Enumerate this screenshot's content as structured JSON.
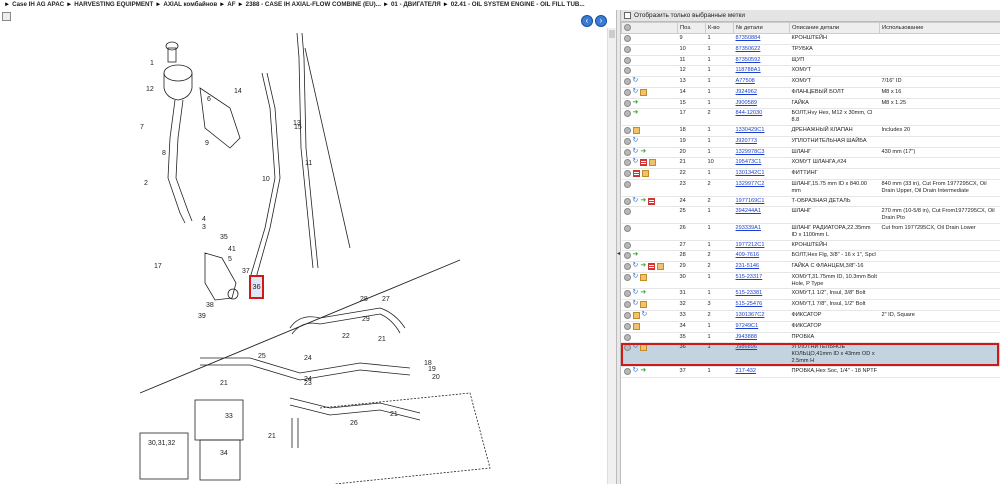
{
  "breadcrumb": [
    "Case IH AG APAC",
    "HARVESTING EQUIPMENT",
    "AXIAL комбайнов",
    "AF",
    "2388 - CASE IH AXIAL-FLOW COMBINE (EU)...",
    "01 - ДВИГАТЕЛЯ",
    "02.41 - OIL SYSTEM ENGINE - OIL FILL TUB..."
  ],
  "nav": {
    "back": "‹",
    "forward": "›"
  },
  "filter": {
    "label": "Отобразить только выбранные метки"
  },
  "table": {
    "headers": [
      "",
      "Поз.",
      "К-во",
      "№ детали",
      "Описание детали",
      "Использование"
    ],
    "rows": [
      {
        "icons": [
          "gear"
        ],
        "pos": "9",
        "qty": "1",
        "part": "87350884",
        "desc": "КРОНШТЕЙН",
        "use": ""
      },
      {
        "icons": [
          "gear"
        ],
        "pos": "10",
        "qty": "1",
        "part": "87350622",
        "desc": "ТРУБКА",
        "use": ""
      },
      {
        "icons": [
          "gear"
        ],
        "pos": "11",
        "qty": "1",
        "part": "87350592",
        "desc": "ЩУП",
        "use": ""
      },
      {
        "icons": [
          "gear"
        ],
        "pos": "12",
        "qty": "1",
        "part": "118788A1",
        "desc": "ХОМУТ",
        "use": ""
      },
      {
        "icons": [
          "gear",
          "refresh"
        ],
        "pos": "13",
        "qty": "1",
        "part": "A77508",
        "desc": "ХОМУТ",
        "use": "7/16\" ID"
      },
      {
        "icons": [
          "gear",
          "refresh",
          "box"
        ],
        "pos": "14",
        "qty": "1",
        "part": "J924962",
        "desc": "ФЛАНЦЕВЫЙ БОЛТ",
        "use": "M8 x 16"
      },
      {
        "icons": [
          "gear",
          "arrow"
        ],
        "pos": "15",
        "qty": "1",
        "part": "J900589",
        "desc": "ГАЙКА",
        "use": "M8 x 1.25"
      },
      {
        "icons": [
          "gear",
          "arrow"
        ],
        "pos": "17",
        "qty": "2",
        "part": "844-12030",
        "desc": "БОЛТ,Hvy Hex, M12 x 30mm, Cl 8.8",
        "use": ""
      },
      {
        "icons": [
          "gear",
          "box"
        ],
        "pos": "18",
        "qty": "1",
        "part": "1330429C1",
        "desc": "ДРЕНАЖНЫЙ КЛАПАН",
        "use": "Includes 20"
      },
      {
        "icons": [
          "gear",
          "refresh"
        ],
        "pos": "19",
        "qty": "1",
        "part": "J920773",
        "desc": "УПЛОТНИТЕЛЬНАЯ ШАЙБА",
        "use": ""
      },
      {
        "icons": [
          "gear",
          "refresh",
          "arrow"
        ],
        "pos": "20",
        "qty": "1",
        "part": "1329978C3",
        "desc": "ШЛАНГ",
        "use": "430 mm (17\")"
      },
      {
        "icons": [
          "gear",
          "refresh",
          "list",
          "box"
        ],
        "pos": "21",
        "qty": "10",
        "part": "195473C1",
        "desc": "ХОМУТ ШЛАНГА,#24",
        "use": ""
      },
      {
        "icons": [
          "gear",
          "list",
          "box"
        ],
        "pos": "22",
        "qty": "1",
        "part": "1301342C1",
        "desc": "ФИТТИНГ",
        "use": ""
      },
      {
        "icons": [
          "gear"
        ],
        "pos": "23",
        "qty": "2",
        "part": "1329977C2",
        "desc": "ШЛАНГ,15.75 mm ID x 840.00 mm",
        "use": "840 mm (33 in), Cut From 1977295CX, Oil Drain Upper, Oil Drain Intermediate"
      },
      {
        "icons": [
          "gear",
          "refresh",
          "arrow",
          "list"
        ],
        "pos": "24",
        "qty": "2",
        "part": "1977169C1",
        "desc": "Т-ОБРАЗНАЯ ДЕТАЛЬ",
        "use": ""
      },
      {
        "icons": [
          "gear"
        ],
        "pos": "25",
        "qty": "1",
        "part": "394244A1",
        "desc": "ШЛАНГ",
        "use": "270 mm (10-5/8 in), Cut From1977295CX, Oil Drain Pto"
      },
      {
        "icons": [
          "gear"
        ],
        "pos": "26",
        "qty": "1",
        "part": "293339A1",
        "desc": "ШЛАНГ РАДИАТОРА,22.35mm ID x 1100mm L",
        "use": "Cut from 1977295CX, Oil Drain Lower"
      },
      {
        "icons": [
          "gear"
        ],
        "pos": "27",
        "qty": "1",
        "part": "1977212C1",
        "desc": "КРОНШТЕЙН",
        "use": ""
      },
      {
        "icons": [
          "gear",
          "arrow"
        ],
        "pos": "28",
        "qty": "2",
        "part": "409-7616",
        "desc": "БОЛТ,Hex Flg, 3/8\" - 16 x 1\", Spcl",
        "use": ""
      },
      {
        "icons": [
          "gear",
          "refresh",
          "arrow",
          "list",
          "box"
        ],
        "pos": "29",
        "qty": "2",
        "part": "231-5146",
        "desc": "ГАЙКА С ФЛАНЦЕМ,3/8\"-16",
        "use": ""
      },
      {
        "icons": [
          "gear",
          "refresh",
          "box"
        ],
        "pos": "30",
        "qty": "1",
        "part": "515-23317",
        "desc": "ХОМУТ,31.75mm ID, 10.3mm Bolt Hole, P Type",
        "use": ""
      },
      {
        "icons": [
          "gear",
          "refresh",
          "arrow"
        ],
        "pos": "31",
        "qty": "1",
        "part": "515-23381",
        "desc": "ХОМУТ,1 1/2\", Insul, 3/8\" Bolt",
        "use": ""
      },
      {
        "icons": [
          "gear",
          "refresh",
          "box"
        ],
        "pos": "32",
        "qty": "3",
        "part": "515-25476",
        "desc": "ХОМУТ,1 7/8\", Insul, 1/2\" Bolt",
        "use": ""
      },
      {
        "icons": [
          "gear",
          "box",
          "refresh"
        ],
        "pos": "33",
        "qty": "2",
        "part": "1301367C2",
        "desc": "ФИКСАТОР",
        "use": "2\" ID, Square"
      },
      {
        "icons": [
          "gear",
          "box"
        ],
        "pos": "34",
        "qty": "1",
        "part": "97249C1",
        "desc": "ФИКСАТОР",
        "use": ""
      },
      {
        "icons": [
          "gear"
        ],
        "pos": "35",
        "qty": "1",
        "part": "J943888",
        "desc": "ПРОБКА",
        "use": ""
      },
      {
        "icons": [
          "gear",
          "refresh",
          "box"
        ],
        "pos": "36",
        "qty": "1",
        "part": "J986896",
        "desc": "УПЛОТНИТЕЛЬНОЕ КОЛЬЦО,41mm ID x 43mm OD x 2.5mm H",
        "use": "",
        "selected": true
      },
      {
        "icons": [
          "gear",
          "refresh",
          "arrow"
        ],
        "pos": "37",
        "qty": "1",
        "part": "217-432",
        "desc": "ПРОБКА,Hex Soc, 1/4\" - 18 NPTF",
        "use": ""
      }
    ]
  },
  "diagram": {
    "callouts": [
      "1",
      "12",
      "6",
      "14",
      "13",
      "7",
      "9",
      "8",
      "15",
      "11",
      "10",
      "2",
      "4",
      "3",
      "35",
      "41",
      "5",
      "37",
      "36",
      "17",
      "38",
      "39",
      "28",
      "27",
      "29",
      "22",
      "21",
      "24",
      "25",
      "21",
      "24",
      "23",
      "21",
      "18",
      "19",
      "20",
      "21",
      "26",
      "33",
      "30,31,32",
      "34"
    ],
    "selected_callout": "36"
  }
}
